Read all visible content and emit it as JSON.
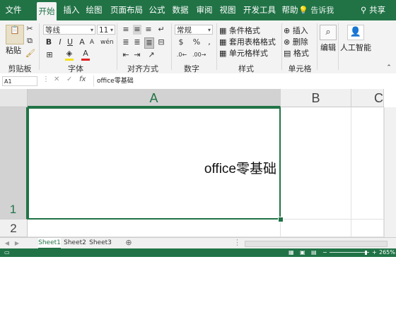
{
  "tabs": [
    "文件",
    "开始",
    "插入",
    "绘图",
    "页面布局",
    "公式",
    "数据",
    "审阅",
    "视图",
    "开发工具",
    "帮助"
  ],
  "active_tab": "开始",
  "tell_me": "告诉我",
  "share": "共享",
  "ribbon": {
    "clipboard": {
      "paste_label": "粘贴",
      "group_label": "剪贴板"
    },
    "font": {
      "font_name": "等线",
      "font_size": "11",
      "group_label": "字体"
    },
    "alignment": {
      "group_label": "对齐方式"
    },
    "number": {
      "format": "常规",
      "group_label": "数字"
    },
    "styles": {
      "conditional": "条件格式",
      "table_format": "套用表格格式",
      "cell_styles": "单元格样式",
      "group_label": "样式"
    },
    "cells": {
      "insert": "插入",
      "delete": "删除",
      "format": "格式",
      "group_label": "单元格"
    },
    "editing": {
      "label": "编辑"
    },
    "ai": {
      "label": "人工智能"
    }
  },
  "formula_bar": {
    "name_box": "A1",
    "content": "office零基础"
  },
  "columns": [
    "A",
    "B",
    "C"
  ],
  "rows": [
    "1",
    "2"
  ],
  "cell_a1": "office零基础",
  "sheets": [
    "Sheet1",
    "Sheet2",
    "Sheet3"
  ],
  "active_sheet": "Sheet1",
  "status": {
    "zoom": "265%"
  }
}
